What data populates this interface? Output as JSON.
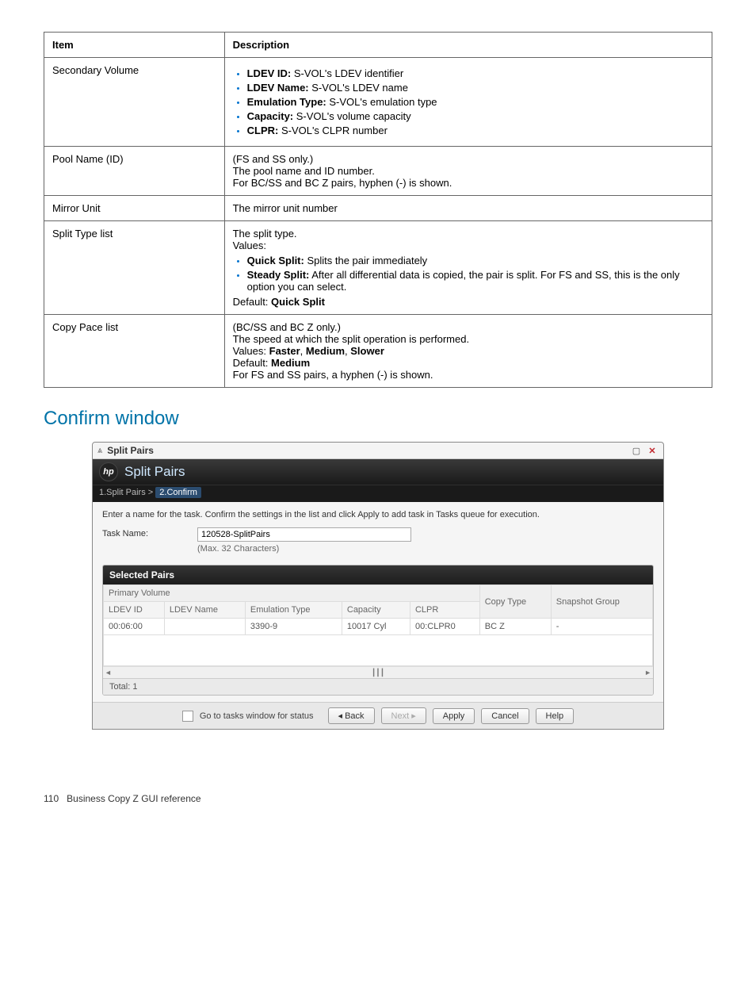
{
  "spec_table": {
    "headers": [
      "Item",
      "Description"
    ],
    "rows": {
      "secondary_volume": {
        "item": "Secondary Volume",
        "bullets": [
          {
            "bold": "LDEV ID:",
            "text": " S-VOL's LDEV identifier"
          },
          {
            "bold": "LDEV Name:",
            "text": " S-VOL's LDEV name"
          },
          {
            "bold": "Emulation Type:",
            "text": " S-VOL's emulation type"
          },
          {
            "bold": "Capacity:",
            "text": " S-VOL's volume capacity"
          },
          {
            "bold": "CLPR:",
            "text": " S-VOL's CLPR number"
          }
        ]
      },
      "pool_name": {
        "item": "Pool Name (ID)",
        "lines": [
          "(FS and SS only.)",
          "The pool name and ID number.",
          "For BC/SS and BC Z pairs, hyphen (-) is shown."
        ]
      },
      "mirror_unit": {
        "item": "Mirror Unit",
        "plain": "The mirror unit number"
      },
      "split_type": {
        "item": "Split Type list",
        "pre_lines": [
          "The split type.",
          "Values:"
        ],
        "bullets": [
          {
            "bold": "Quick Split:",
            "text": " Splits the pair immediately"
          },
          {
            "bold": "Steady Split:",
            "text": " After all differential data is copied, the pair is split. For FS and SS, this is the only option you can select."
          }
        ],
        "post_line_prefix": "Default: ",
        "post_line_bold": "Quick Split"
      },
      "copy_pace": {
        "item": "Copy Pace list",
        "line1": "(BC/SS and BC Z only.)",
        "line2": "The speed at which the split operation is performed.",
        "line3_prefix": "Values: ",
        "line3_bold": "Faster",
        "line3_mid1": ", ",
        "line3_bold2": "Medium",
        "line3_mid2": ", ",
        "line3_bold3": "Slower",
        "line4_prefix": "Default: ",
        "line4_bold": "Medium",
        "line5": "For FS and SS pairs, a hyphen (-) is shown."
      }
    }
  },
  "section_title": "Confirm window",
  "screenshot": {
    "titlebar": {
      "title": "Split Pairs"
    },
    "header": {
      "logo": "hp",
      "title": "Split Pairs"
    },
    "steps": {
      "step1": "1.Split Pairs",
      "arrow": ">",
      "step2": "2.Confirm"
    },
    "hint": "Enter a name for the task. Confirm the settings in the list and click Apply to add task in Tasks queue for execution.",
    "task": {
      "label": "Task Name:",
      "value": "120528-SplitPairs",
      "sub": "(Max. 32 Characters)"
    },
    "panel_title": "Selected Pairs",
    "grid": {
      "group_header": "Primary Volume",
      "cols": [
        "LDEV ID",
        "LDEV Name",
        "Emulation Type",
        "Capacity",
        "CLPR",
        "Copy Type",
        "Snapshot Group"
      ],
      "row": [
        "00:06:00",
        "",
        "3390-9",
        "10017 Cyl",
        "00:CLPR0",
        "BC Z",
        "-"
      ]
    },
    "total": "Total: 1",
    "footer": {
      "chk_label": "Go to tasks window for status",
      "back": "Back",
      "next": "Next",
      "apply": "Apply",
      "cancel": "Cancel",
      "help": "Help"
    }
  },
  "page_footer": {
    "num": "110",
    "text": "Business Copy Z GUI reference"
  }
}
